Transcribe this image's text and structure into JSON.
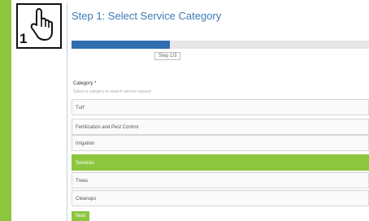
{
  "step": {
    "number": "1",
    "title": "Step 1: Select Service Category"
  },
  "progress": {
    "label": "Step 1/3",
    "fraction": 0.33
  },
  "form": {
    "label": "Category *",
    "hint": "Select a category to search service request"
  },
  "options": [
    {
      "label": "Turf",
      "selected": false
    },
    {
      "label": "Fertilization and Pest Control",
      "selected": false
    },
    {
      "label": "Irrigation",
      "selected": false
    },
    {
      "label": "Services",
      "selected": true
    },
    {
      "label": "Trees",
      "selected": false
    },
    {
      "label": "Cleanups",
      "selected": false
    }
  ],
  "buttons": {
    "next": "Next"
  },
  "colors": {
    "accent_green": "#8cc63f",
    "progress_blue": "#2f6db0",
    "title_blue": "#3d7ab8"
  },
  "icons": {
    "step_badge": "pointing-hand-icon"
  }
}
